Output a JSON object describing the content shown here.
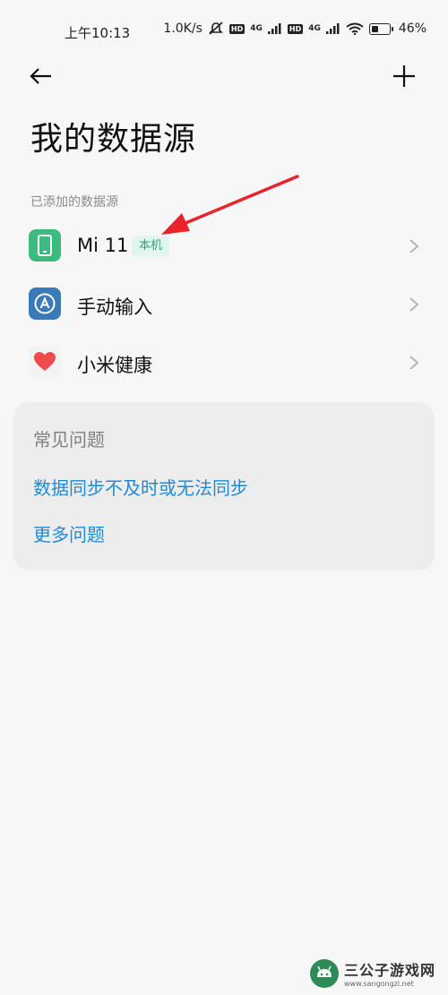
{
  "status_bar": {
    "time": "上午10:13",
    "net_speed": "1.0K/s",
    "hd1": "HD",
    "net1": "4G",
    "hd2": "HD",
    "net2": "4G",
    "battery_text": "46%",
    "battery_level_pct": 46
  },
  "nav": {
    "back_icon": "arrow-left-icon",
    "add_icon": "plus-icon"
  },
  "page": {
    "title": "我的数据源",
    "section_label": "已添加的数据源"
  },
  "sources": [
    {
      "label": "Mi 11",
      "badge": "本机",
      "icon": "phone-icon",
      "color": "#3dbb7f"
    },
    {
      "label": "手动输入",
      "icon": "manual-input-icon",
      "color": "#3a7ab6"
    },
    {
      "label": "小米健康",
      "icon": "heart-icon",
      "color": "#ee4b4b"
    }
  ],
  "faq": {
    "title": "常见问题",
    "links": [
      "数据同步不及时或无法同步",
      "更多问题"
    ]
  },
  "watermark": {
    "main": "三公子游戏网",
    "sub": "www.sangongzi.net"
  },
  "annotation": {
    "arrow_color": "#e8232b"
  }
}
